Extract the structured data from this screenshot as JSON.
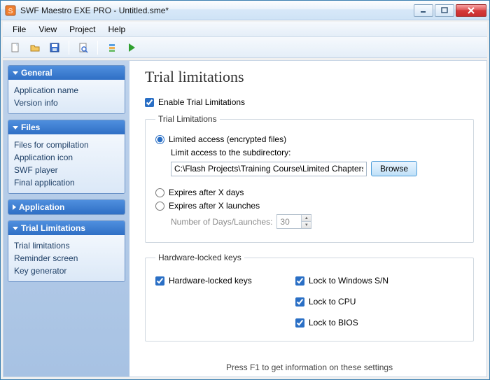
{
  "window": {
    "title": "SWF Maestro EXE PRO - Untitled.sme*"
  },
  "menu": {
    "items": [
      "File",
      "View",
      "Project",
      "Help"
    ]
  },
  "toolbar": {
    "icons": [
      "new-icon",
      "open-icon",
      "save-icon",
      "preview-icon",
      "build-icon",
      "play-icon"
    ]
  },
  "sidebar": {
    "groups": [
      {
        "title": "General",
        "collapsed": false,
        "items": [
          "Application name",
          "Version info"
        ]
      },
      {
        "title": "Files",
        "collapsed": false,
        "items": [
          "Files for compilation",
          "Application icon",
          "SWF player",
          "Final application"
        ]
      },
      {
        "title": "Application",
        "collapsed": true,
        "items": []
      },
      {
        "title": "Trial Limitations",
        "collapsed": false,
        "items": [
          "Trial limitations",
          "Reminder screen",
          "Key generator"
        ]
      }
    ]
  },
  "page": {
    "title": "Trial limitations",
    "enable_label": "Enable Trial Limitations",
    "enable_checked": true,
    "fieldset_trial": "Trial Limitations",
    "opt_limited_label": "Limited access (encrypted files)",
    "opt_limited_selected": true,
    "subdir_label": "Limit access to the subdirectory:",
    "subdir_value": "C:\\Flash Projects\\Training Course\\Limited Chapters\\",
    "browse_label": "Browse",
    "opt_days_label": "Expires after X days",
    "opt_launches_label": "Expires after X launches",
    "num_label": "Number of Days/Launches:",
    "num_value": "30",
    "fieldset_hw": "Hardware-locked keys",
    "hw_enable_label": "Hardware-locked keys",
    "hw_enable_checked": true,
    "hw_win_label": "Lock to Windows S/N",
    "hw_win_checked": true,
    "hw_cpu_label": "Lock to CPU",
    "hw_cpu_checked": true,
    "hw_bios_label": "Lock to BIOS",
    "hw_bios_checked": true,
    "footer_hint": "Press F1 to get information on these settings"
  }
}
